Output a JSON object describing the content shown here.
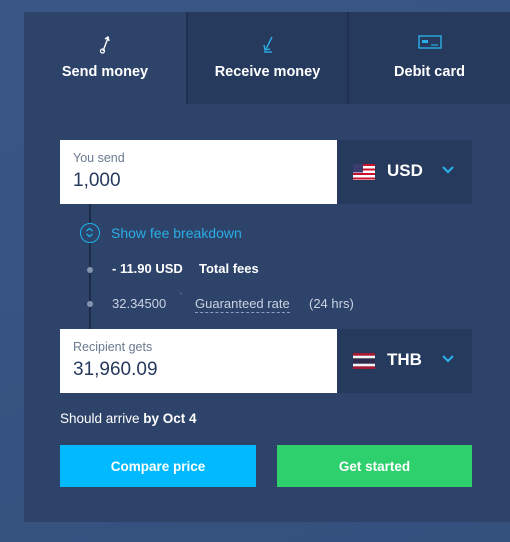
{
  "tabs": [
    {
      "label": "Send money",
      "icon": "send-arrow-icon",
      "active": true
    },
    {
      "label": "Receive money",
      "icon": "receive-arrow-icon",
      "active": false
    },
    {
      "label": "Debit card",
      "icon": "card-icon",
      "active": false
    }
  ],
  "send": {
    "label": "You send",
    "amount": "1,000",
    "currency": "USD",
    "flag": "us-flag-icon"
  },
  "fees": {
    "link": "Show fee breakdown",
    "amount": "- 11.90 USD",
    "amount_label": "Total fees",
    "rate": "32.34500",
    "rate_label": "Guaranteed rate",
    "rate_suffix": "(24 hrs)"
  },
  "receive": {
    "label": "Recipient gets",
    "amount": "31,960.09",
    "currency": "THB",
    "flag": "th-flag-icon"
  },
  "arrival": {
    "prefix": "Should arrive ",
    "date": "by Oct 4"
  },
  "buttons": {
    "compare": "Compare price",
    "start": "Get started"
  },
  "colors": {
    "compare": "#00b9ff",
    "start": "#2ed06e",
    "link": "#2aaee5",
    "panel": "#2e4369"
  }
}
